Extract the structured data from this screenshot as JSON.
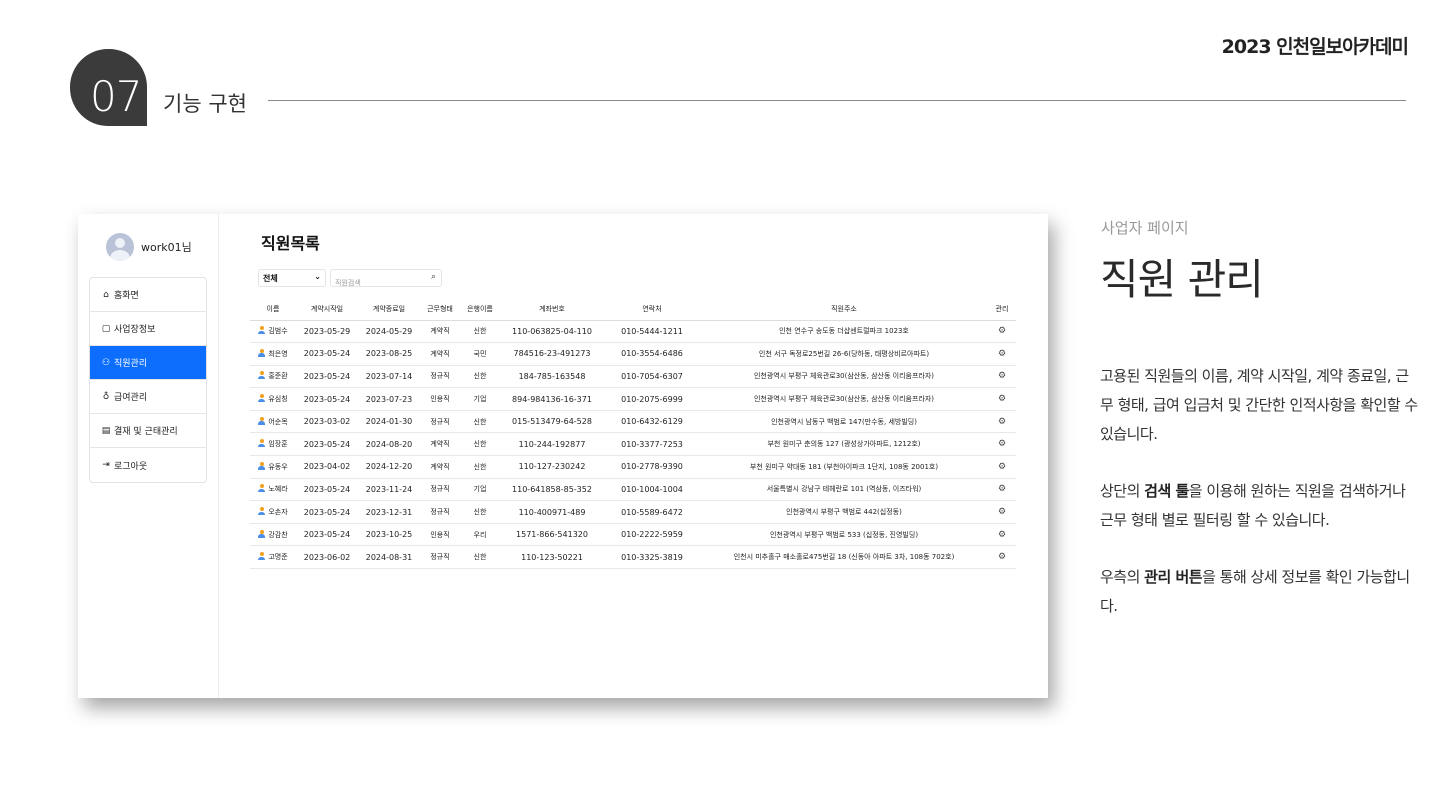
{
  "slide": {
    "brand": "2023 인천일보아카데미",
    "section_number": "07",
    "section_title": "기능 구현"
  },
  "app": {
    "user_name": "work01님",
    "menu": [
      {
        "icon": "home-icon",
        "glyph": "⌂",
        "label": "홈화면"
      },
      {
        "icon": "briefcase-icon",
        "glyph": "▢",
        "label": "사업장정보"
      },
      {
        "icon": "people-icon",
        "glyph": "⚇",
        "label": "직원관리",
        "active": true
      },
      {
        "icon": "moneybag-icon",
        "glyph": "♁",
        "label": "급여관리"
      },
      {
        "icon": "calendar-icon",
        "glyph": "▤",
        "label": "결재 및 근태관리"
      },
      {
        "icon": "logout-icon",
        "glyph": "⇥",
        "label": "로그아웃"
      }
    ],
    "page_title": "직원목록",
    "filter_value": "전체",
    "search_placeholder": "직원검색",
    "table": {
      "headers": [
        "이름",
        "계약시작일",
        "계약종료일",
        "근무형태",
        "은행이름",
        "계좌번호",
        "연락처",
        "직원주소",
        "관리"
      ],
      "rows": [
        [
          "김범수",
          "2023-05-29",
          "2024-05-29",
          "계약직",
          "신한",
          "110-063825-04-110",
          "010-5444-1211",
          "인천 연수구 송도동 더샵센트럴파크 1023호"
        ],
        [
          "최은영",
          "2023-05-24",
          "2023-08-25",
          "계약직",
          "국민",
          "784516-23-491273",
          "010-3554-6486",
          "인천 서구 독정로25번길 26-6(당하동, 태평상비르아파트)"
        ],
        [
          "홍준환",
          "2023-05-24",
          "2023-07-14",
          "정규직",
          "신한",
          "184-785-163548",
          "010-7054-6307",
          "인천광역시 부평구 체육관로30(삼산동, 삼산동 이리움프라자)"
        ],
        [
          "유심칭",
          "2023-05-24",
          "2023-07-23",
          "인용직",
          "기업",
          "894-984136-16-371",
          "010-2075-6999",
          "인천광역시 부평구 체육관로30(삼산동, 삼산동 이리움프라자)"
        ],
        [
          "어순목",
          "2023-03-02",
          "2024-01-30",
          "정규직",
          "신한",
          "015-513479-64-528",
          "010-6432-6129",
          "인천광역시 남동구 백범로 147(만수동, 세방빌딩)"
        ],
        [
          "임장훈",
          "2023-05-24",
          "2024-08-20",
          "계약직",
          "신한",
          "110-244-192877",
          "010-3377-7253",
          "부천 원미구 춘의동 127 (광성상가아파트, 1212호)"
        ],
        [
          "유동우",
          "2023-04-02",
          "2024-12-20",
          "계약직",
          "신한",
          "110-127-230242",
          "010-2778-9390",
          "부천 원미구 약대동 181 (부천아이파크 1단지, 108동 2001호)"
        ],
        [
          "노혜라",
          "2023-05-24",
          "2023-11-24",
          "정규직",
          "기업",
          "110-641858-85-352",
          "010-1004-1004",
          "서울특별시 강남구 테헤란로 101 (역삼동, 이즈타워)"
        ],
        [
          "오손자",
          "2023-05-24",
          "2023-12-31",
          "정규직",
          "신한",
          "110-400971-489",
          "010-5589-6472",
          "인천광역시 부평구 백범로 442(십정동)"
        ],
        [
          "강감찬",
          "2023-05-24",
          "2023-10-25",
          "인용직",
          "우리",
          "1571-866-541320",
          "010-2222-5959",
          "인천광역시 부평구 백범로 533 (십정동, 진영빌딩)"
        ],
        [
          "고명준",
          "2023-06-02",
          "2024-08-31",
          "정규직",
          "신한",
          "110-123-50221",
          "010-3325-3819",
          "인천시 미추홀구 매소홀로475번길 18 (신동아 아파트 3차, 108동 702호)"
        ]
      ]
    }
  },
  "description": {
    "subtitle": "사업자 페이지",
    "title": "직원 관리",
    "para1": "고용된 직원들의 이름, 계약 시작일, 계약 종료일, 근무 형태, 급여 입금처 및 간단한 인적사항을 확인할 수 있습니다.",
    "para2_pre": "상단의 ",
    "para2_bold": "검색 툴",
    "para2_post": "을 이용해 원하는 직원을 검색하거나 근무 형태 별로 필터링 할 수 있습니다.",
    "para3_pre": "우측의 ",
    "para3_bold": "관리 버튼",
    "para3_post": "을 통해 상세 정보를 확인 가능합니다."
  }
}
